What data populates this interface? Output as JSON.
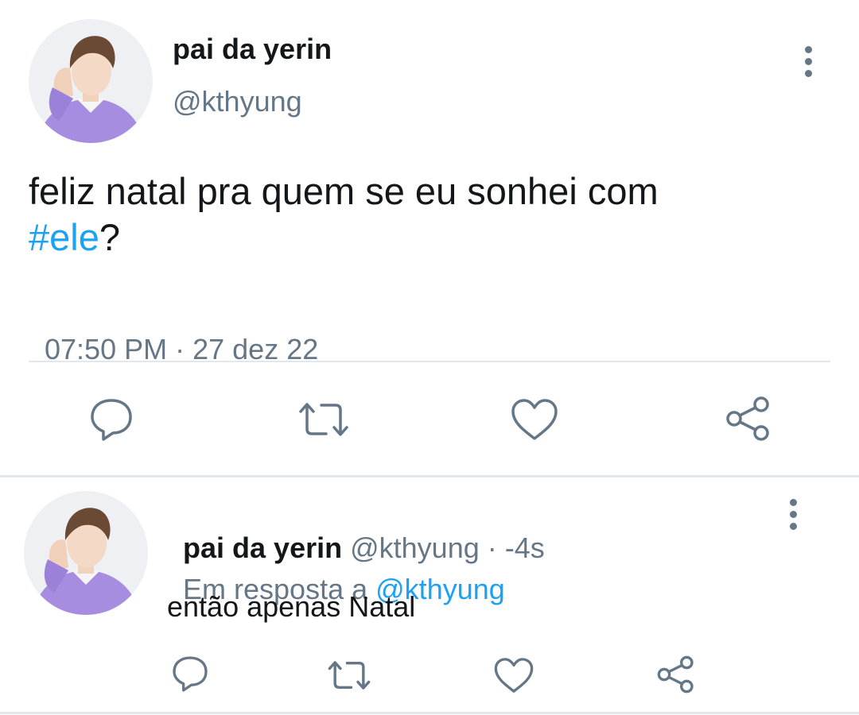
{
  "tweet": {
    "author_name": "pai da yerin",
    "author_handle": "@kthyung",
    "text_prefix": "feliz natal pra quem se eu sonhei com",
    "hashtag": "#ele",
    "text_suffix": "?",
    "time": "07:50 PM",
    "separator": " · ",
    "date": "27 dez 22",
    "actions": [
      "reply-icon",
      "retweet-icon",
      "like-icon",
      "share-icon"
    ]
  },
  "reply": {
    "author_name": "pai da yerin",
    "author_handle": "@kthyung",
    "separator": " · ",
    "time_ago": "-4s",
    "in_reply_prefix": "Em resposta a",
    "in_reply_handle": "@kthyung",
    "text": "então apenas Natal",
    "actions": [
      "reply-icon",
      "retweet-icon",
      "like-icon",
      "share-icon"
    ]
  },
  "colors": {
    "link": "#1da1f2",
    "muted": "#657786",
    "text": "#14171a",
    "divider": "#e1e8ed",
    "sweater": "#a68de0"
  }
}
